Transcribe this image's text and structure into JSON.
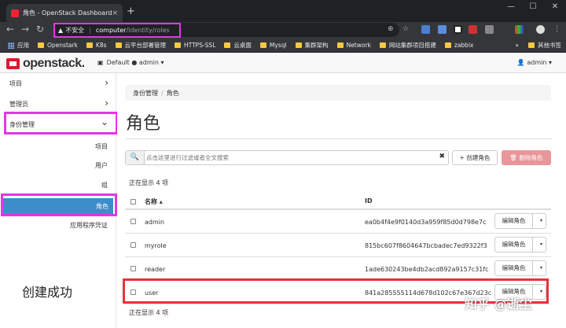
{
  "browser": {
    "tab_title": "角色 - OpenStack Dashboard",
    "tab_close": "×",
    "new_tab": "+",
    "window_controls": [
      "—",
      "☐",
      "✕"
    ],
    "nav": {
      "back": "←",
      "forward": "→",
      "reload": "↻"
    },
    "security_label": "不安全",
    "url_host": "computer",
    "url_path": "/identity/roles"
  },
  "bookmarks": [
    {
      "label": "应用",
      "type": "apps"
    },
    {
      "label": "Openstark",
      "type": "folder"
    },
    {
      "label": "K8s",
      "type": "folder"
    },
    {
      "label": "云平台部署管理",
      "type": "folder"
    },
    {
      "label": "HTTPS-SSL",
      "type": "folder"
    },
    {
      "label": "云桌面",
      "type": "folder"
    },
    {
      "label": "Mysql",
      "type": "folder"
    },
    {
      "label": "集群架构",
      "type": "folder"
    },
    {
      "label": "Network",
      "type": "folder"
    },
    {
      "label": "网站集群项目搭建",
      "type": "folder"
    },
    {
      "label": "zabbix",
      "type": "folder"
    }
  ],
  "bookmarks_more": {
    "overflow": "»",
    "label": "其他书签"
  },
  "header": {
    "logo_text": "openstack.",
    "project_label": "Default ● admin ▾",
    "user_label": "admin ▾"
  },
  "sidebar": {
    "items": [
      {
        "label": "项目",
        "chevron": "›"
      },
      {
        "label": "管理员",
        "chevron": "›"
      },
      {
        "label": "身份管理",
        "chevron": "⌄"
      }
    ],
    "sub_items": [
      "项目",
      "用户",
      "组",
      "角色",
      "应用程序凭证"
    ]
  },
  "annotation": "创建成功",
  "breadcrumb": [
    "身份管理",
    "角色"
  ],
  "breadcrumb_sep": "/",
  "page_title": "角色",
  "toolbar": {
    "search_icon": "🔍",
    "search_placeholder": "点击这里进行过滤或者全文搜索",
    "clear_icon": "✖",
    "create_label": "+ 创建角色",
    "delete_label": "🗑 删除角色"
  },
  "table": {
    "count_label": "正在显示 4 项",
    "col_name": "名称 ▴",
    "col_id": "ID",
    "edit_label": "编辑角色",
    "caret": "▾",
    "rows": [
      {
        "name": "admin",
        "id": "ea0b4f4e9f0140d3a959f85d0d798e7c"
      },
      {
        "name": "myrole",
        "id": "815bc607f8604647bcbadec7ed9322f3"
      },
      {
        "name": "reader",
        "id": "1ade630243be4db2acd892a9157c31fc"
      },
      {
        "name": "user",
        "id": "841a285555114d678d102c67e367d23c"
      }
    ]
  },
  "watermark": "知乎 @逝尘",
  "colors": {
    "highlight_magenta": "#e535e5",
    "highlight_red": "#e8333b",
    "active_blue": "#3c8dca",
    "brand_red": "#da1a32"
  }
}
